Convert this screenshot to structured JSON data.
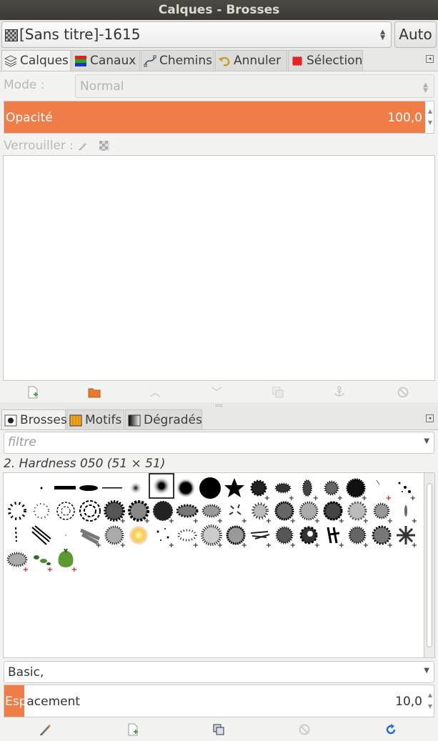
{
  "window": {
    "title": "Calques - Brosses"
  },
  "image_selector": {
    "name": "[Sans titre]-1615",
    "auto_label": "Auto"
  },
  "top_tabs": [
    {
      "label": "Calques",
      "icon": "layers-icon",
      "active": true
    },
    {
      "label": "Canaux",
      "icon": "channels-icon",
      "active": false
    },
    {
      "label": "Chemins",
      "icon": "paths-icon",
      "active": false
    },
    {
      "label": "Annuler",
      "icon": "undo-icon",
      "active": false
    },
    {
      "label": "Sélection",
      "icon": "selection-icon",
      "active": false
    }
  ],
  "layers": {
    "mode_label": "Mode :",
    "mode_value": "Normal",
    "opacity_label": "Opacité",
    "opacity_value": "100,0",
    "opacity_fraction": 0.98,
    "lock_label": "Verrouiller :",
    "lock_icons": [
      "brush-lock-icon",
      "alpha-lock-icon"
    ],
    "buttons": [
      "new-layer-icon",
      "new-group-icon",
      "raise-layer-icon",
      "lower-layer-icon",
      "duplicate-layer-icon",
      "anchor-layer-icon",
      "delete-layer-icon"
    ]
  },
  "bottom_tabs": [
    {
      "label": "Brosses",
      "icon": "brushes-icon",
      "active": true
    },
    {
      "label": "Motifs",
      "icon": "patterns-icon",
      "active": false
    },
    {
      "label": "Dégradés",
      "icon": "gradients-icon",
      "active": false
    }
  ],
  "brushes": {
    "filter_placeholder": "filtre",
    "selected_name": "2. Hardness 050 (51 × 51)",
    "tag_value": "Basic,",
    "spacing_label": "Espacement",
    "spacing_value": "10,0",
    "spacing_fraction": 0.047,
    "buttons": [
      "edit-brush-icon",
      "new-brush-icon",
      "duplicate-brush-icon",
      "delete-brush-icon",
      "refresh-brushes-icon"
    ],
    "accent_color": "#f07c48"
  }
}
